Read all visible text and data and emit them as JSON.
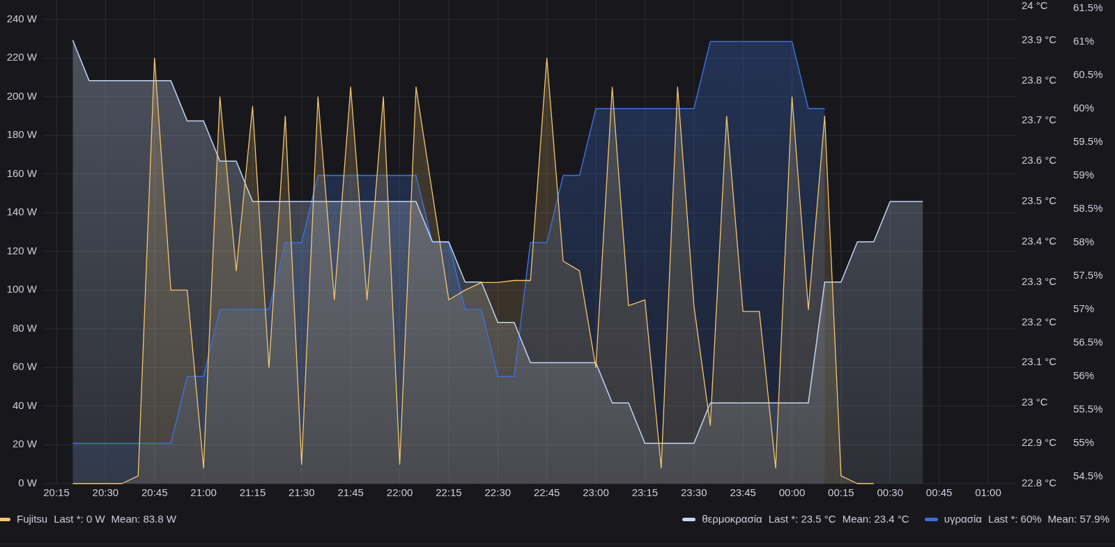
{
  "panel": {
    "chart_data": {
      "type": "area",
      "grid": true,
      "categories": [
        "20:15",
        null,
        null,
        "20:30",
        null,
        null,
        "20:45",
        null,
        null,
        "21:00",
        null,
        null,
        "21:15",
        null,
        null,
        "21:30",
        null,
        null,
        "21:45",
        null,
        null,
        "22:00",
        null,
        null,
        "22:15",
        null,
        null,
        "22:30",
        null,
        null,
        "22:45",
        null,
        null,
        "23:00",
        null,
        null,
        "23:15",
        null,
        null,
        "23:30",
        null,
        null,
        "23:45",
        null,
        null,
        "00:00",
        null,
        null,
        "00:15",
        null,
        null,
        "00:30",
        null,
        null,
        "00:45",
        null,
        null,
        "01:00"
      ],
      "series": [
        {
          "name": "Fujitsu",
          "color": "#f5c66e",
          "values": [
            null,
            0,
            0,
            0,
            0,
            4,
            220,
            100,
            100,
            8,
            200,
            110,
            195,
            60,
            190,
            10,
            200,
            95,
            205,
            95,
            200,
            10,
            205,
            150,
            95,
            100,
            104,
            104,
            105,
            105,
            220,
            115,
            110,
            60,
            205,
            92,
            95,
            8,
            205,
            92,
            30,
            190,
            89,
            89,
            8,
            200,
            90,
            190,
            4,
            0,
            0,
            null,
            null,
            null,
            null,
            null,
            null,
            null
          ]
        },
        {
          "name": "θερμοκρασία",
          "color": "#c4d7f5",
          "axis": "y2",
          "values": [
            null,
            23.9,
            23.8,
            23.8,
            23.8,
            23.8,
            23.8,
            23.8,
            23.7,
            23.7,
            23.6,
            23.6,
            23.5,
            23.5,
            23.5,
            23.5,
            23.5,
            23.5,
            23.5,
            23.5,
            23.5,
            23.5,
            23.5,
            23.4,
            23.4,
            23.3,
            23.3,
            23.2,
            23.2,
            23.1,
            23.1,
            23.1,
            23.1,
            23.1,
            23.0,
            23.0,
            22.9,
            22.9,
            22.9,
            22.9,
            23.0,
            23.0,
            23.0,
            23.0,
            23.0,
            23.0,
            23.0,
            23.3,
            23.3,
            23.4,
            23.4,
            23.5,
            23.5,
            23.5,
            null,
            null,
            null,
            null
          ]
        },
        {
          "name": "υγρασία",
          "color": "#3d6fd6",
          "axis": "y3",
          "values": [
            null,
            55,
            55,
            55,
            55,
            55,
            55,
            55,
            56,
            56,
            57,
            57,
            57,
            57,
            58,
            58,
            59,
            59,
            59,
            59,
            59,
            59,
            59,
            58,
            58,
            57,
            57,
            56,
            56,
            58,
            58,
            59,
            59,
            60,
            60,
            60,
            60,
            60,
            60,
            60,
            61,
            61,
            61,
            61,
            61,
            61,
            60,
            60,
            null,
            null,
            null,
            null,
            null,
            null,
            null,
            null,
            null,
            null
          ]
        }
      ],
      "ylim": [
        0,
        250
      ],
      "y2lim": [
        22.8,
        24.0
      ],
      "y3lim": [
        54.4,
        61.62
      ],
      "yticks": [
        {
          "value": 0,
          "label": "0 W"
        },
        {
          "value": 20,
          "label": "20 W"
        },
        {
          "value": 40,
          "label": "40 W"
        },
        {
          "value": 60,
          "label": "60 W"
        },
        {
          "value": 80,
          "label": "80 W"
        },
        {
          "value": 100,
          "label": "100 W"
        },
        {
          "value": 120,
          "label": "120 W"
        },
        {
          "value": 140,
          "label": "140 W"
        },
        {
          "value": 160,
          "label": "160 W"
        },
        {
          "value": 180,
          "label": "180 W"
        },
        {
          "value": 200,
          "label": "200 W"
        },
        {
          "value": 220,
          "label": "220 W"
        },
        {
          "value": 240,
          "label": "240 W"
        }
      ],
      "y2ticks": [
        {
          "value": 22.8,
          "label": "22.8 °C"
        },
        {
          "value": 22.9,
          "label": "22.9 °C"
        },
        {
          "value": 23.0,
          "label": "23 °C"
        },
        {
          "value": 23.1,
          "label": "23.1 °C"
        },
        {
          "value": 23.2,
          "label": "23.2 °C"
        },
        {
          "value": 23.3,
          "label": "23.3 °C"
        },
        {
          "value": 23.4,
          "label": "23.4 °C"
        },
        {
          "value": 23.5,
          "label": "23.5 °C"
        },
        {
          "value": 23.6,
          "label": "23.6 °C"
        },
        {
          "value": 23.7,
          "label": "23.7 °C"
        },
        {
          "value": 23.8,
          "label": "23.8 °C"
        },
        {
          "value": 23.9,
          "label": "23.9 °C"
        },
        {
          "value": 24.0,
          "label": "24 °C"
        }
      ],
      "y3ticks": [
        {
          "value": 54.5,
          "label": "54.5%"
        },
        {
          "value": 55,
          "label": "55%"
        },
        {
          "value": 55.5,
          "label": "55.5%"
        },
        {
          "value": 56,
          "label": "56%"
        },
        {
          "value": 56.5,
          "label": "56.5%"
        },
        {
          "value": 57,
          "label": "57%"
        },
        {
          "value": 57.5,
          "label": "57.5%"
        },
        {
          "value": 58,
          "label": "58%"
        },
        {
          "value": 58.5,
          "label": "58.5%"
        },
        {
          "value": 59,
          "label": "59%"
        },
        {
          "value": 59.5,
          "label": "59.5%"
        },
        {
          "value": 60,
          "label": "60%"
        },
        {
          "value": 60.5,
          "label": "60.5%"
        },
        {
          "value": 61,
          "label": "61%"
        },
        {
          "value": 61.5,
          "label": "61.5%"
        }
      ]
    },
    "legend": [
      {
        "last": "Last *: 0 W",
        "mean": "Mean: 83.8 W"
      },
      {
        "last": "Last *: 23.5 °C",
        "mean": "Mean: 23.4 °C"
      },
      {
        "last": "Last *: 60%",
        "mean": "Mean: 57.9%"
      }
    ]
  }
}
